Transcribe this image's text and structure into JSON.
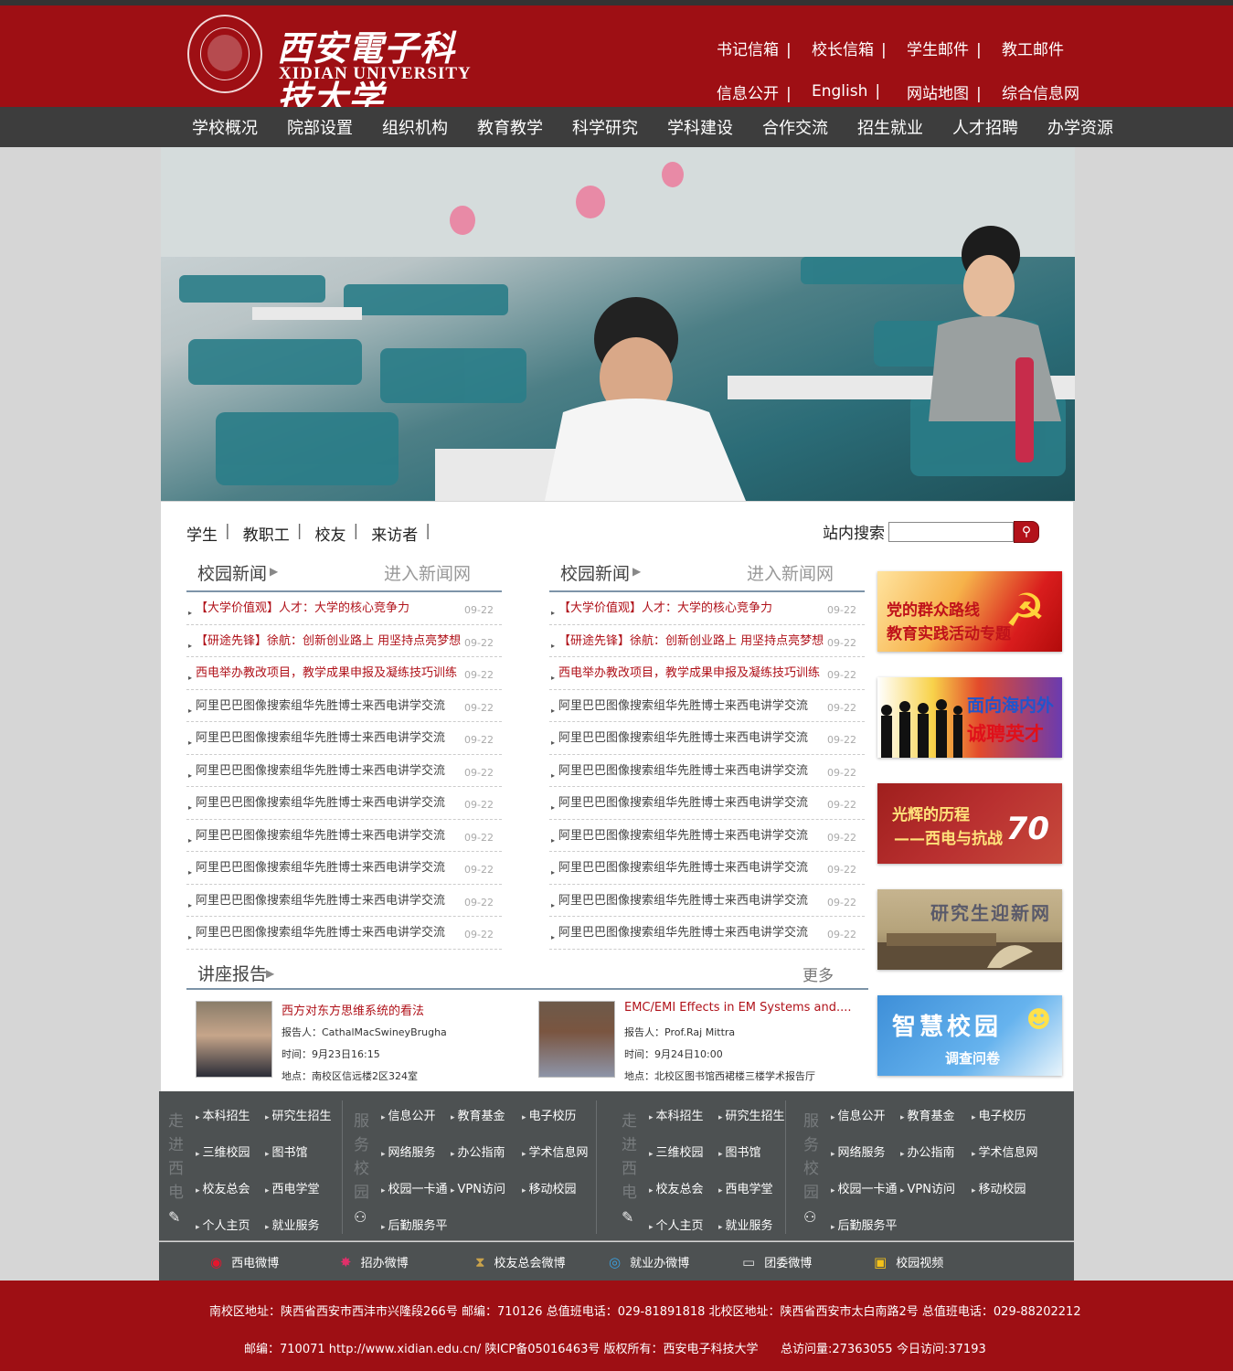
{
  "header": {
    "logo_cn": "西安電子科技大学",
    "logo_en": "XIDIAN UNIVERSITY",
    "links_row1": [
      "书记信箱",
      "校长信箱",
      "学生邮件",
      "教工邮件"
    ],
    "links_row2": [
      "信息公开",
      "English",
      "网站地图",
      "综合信息网"
    ],
    "separator": "|"
  },
  "nav": [
    "学校概况",
    "院部设置",
    "组织机构",
    "教育教学",
    "科学研究",
    "学科建设",
    "合作交流",
    "招生就业",
    "人才招聘",
    "办学资源"
  ],
  "audience": [
    "学生",
    "教职工",
    "校友",
    "来访者"
  ],
  "search": {
    "label": "站内搜索",
    "placeholder": "",
    "button_icon": "search-icon"
  },
  "news_columns": [
    {
      "title": "校园新闻",
      "more": "进入新闻网",
      "items": [
        {
          "text": "【大学价值观】人才：大学的核心竞争力",
          "date": "09-22",
          "red": true
        },
        {
          "text": "【研途先锋】徐航：创新创业路上 用坚持点亮梦想",
          "date": "09-22",
          "red": true
        },
        {
          "text": "西电举办教改项目，教学成果申报及凝练技巧训练",
          "date": "09-22",
          "red": true
        },
        {
          "text": "阿里巴巴图像搜索组华先胜博士来西电讲学交流",
          "date": "09-22",
          "red": false
        },
        {
          "text": "阿里巴巴图像搜索组华先胜博士来西电讲学交流",
          "date": "09-22",
          "red": false
        },
        {
          "text": "阿里巴巴图像搜索组华先胜博士来西电讲学交流",
          "date": "09-22",
          "red": false
        },
        {
          "text": "阿里巴巴图像搜索组华先胜博士来西电讲学交流",
          "date": "09-22",
          "red": false
        },
        {
          "text": "阿里巴巴图像搜索组华先胜博士来西电讲学交流",
          "date": "09-22",
          "red": false
        },
        {
          "text": "阿里巴巴图像搜索组华先胜博士来西电讲学交流",
          "date": "09-22",
          "red": false
        },
        {
          "text": "阿里巴巴图像搜索组华先胜博士来西电讲学交流",
          "date": "09-22",
          "red": false
        },
        {
          "text": "阿里巴巴图像搜索组华先胜博士来西电讲学交流",
          "date": "09-22",
          "red": false
        }
      ]
    },
    {
      "title": "校园新闻",
      "more": "进入新闻网",
      "items": [
        {
          "text": "【大学价值观】人才：大学的核心竞争力",
          "date": "09-22",
          "red": true
        },
        {
          "text": "【研途先锋】徐航：创新创业路上 用坚持点亮梦想",
          "date": "09-22",
          "red": true
        },
        {
          "text": "西电举办教改项目，教学成果申报及凝练技巧训练",
          "date": "09-22",
          "red": true
        },
        {
          "text": "阿里巴巴图像搜索组华先胜博士来西电讲学交流",
          "date": "09-22",
          "red": false
        },
        {
          "text": "阿里巴巴图像搜索组华先胜博士来西电讲学交流",
          "date": "09-22",
          "red": false
        },
        {
          "text": "阿里巴巴图像搜索组华先胜博士来西电讲学交流",
          "date": "09-22",
          "red": false
        },
        {
          "text": "阿里巴巴图像搜索组华先胜博士来西电讲学交流",
          "date": "09-22",
          "red": false
        },
        {
          "text": "阿里巴巴图像搜索组华先胜博士来西电讲学交流",
          "date": "09-22",
          "red": false
        },
        {
          "text": "阿里巴巴图像搜索组华先胜博士来西电讲学交流",
          "date": "09-22",
          "red": false
        },
        {
          "text": "阿里巴巴图像搜索组华先胜博士来西电讲学交流",
          "date": "09-22",
          "red": false
        },
        {
          "text": "阿里巴巴图像搜索组华先胜博士来西电讲学交流",
          "date": "09-22",
          "red": false
        }
      ]
    }
  ],
  "ads": [
    {
      "line1": "党的群众路线",
      "line2": "教育实践活动专题",
      "icon": "hammer-sickle-icon"
    },
    {
      "line1": "面向海内外",
      "line2": "诚聘英才"
    },
    {
      "line1": "光辉的历程",
      "line2": "——西电与抗战",
      "badge": "70"
    },
    {
      "line1": "研究生迎新网"
    },
    {
      "line1": "智慧校园",
      "line2": "调查问卷"
    }
  ],
  "lectures": {
    "title": "讲座报告",
    "more": "更多",
    "items": [
      {
        "title": "西方对东方思维系统的看法",
        "speaker": "报告人：CathalMacSwineyBrugha",
        "time": "时间：9月23日16:15",
        "place": "地点：南校区信远楼2区324室"
      },
      {
        "title": "EMC/EMI Effects in EM Systems and....",
        "speaker": "报告人：Prof.Raj Mittra",
        "time": "时间：9月24日10:00",
        "place": "地点：北校区图书馆西裙楼三楼学术报告厅"
      }
    ]
  },
  "footer_groups": [
    {
      "label": "走进西电",
      "cells": [
        "本科招生",
        "研究生招生",
        "三维校园",
        "图书馆",
        "校友总会",
        "西电学堂",
        "个人主页",
        "就业服务"
      ],
      "icon": "edit-icon"
    },
    {
      "label": "服务校园",
      "cells": [
        "信息公开",
        "教育基金",
        "电子校历",
        "网络服务",
        "办公指南",
        "学术信息网",
        "校园一卡通",
        "VPN访问",
        "移动校园",
        "后勤服务平"
      ],
      "icon": "users-icon"
    },
    {
      "label": "走进西电",
      "cells": [
        "本科招生",
        "研究生招生",
        "三维校园",
        "图书馆",
        "校友总会",
        "西电学堂",
        "个人主页",
        "就业服务"
      ],
      "icon": "edit-icon"
    },
    {
      "label": "服务校园",
      "cells": [
        "信息公开",
        "教育基金",
        "电子校历",
        "网络服务",
        "办公指南",
        "学术信息网",
        "校园一卡通",
        "VPN访问",
        "移动校园",
        "后勤服务平"
      ],
      "icon": "users-icon"
    }
  ],
  "weibo": [
    {
      "label": "西电微博",
      "icon": "weibo-icon"
    },
    {
      "label": "招办微博",
      "icon": "star-icon"
    },
    {
      "label": "校友总会微博",
      "icon": "hourglass-icon"
    },
    {
      "label": "就业办微博",
      "icon": "eye-icon"
    },
    {
      "label": "团委微博",
      "icon": "card-icon"
    },
    {
      "label": "校园视频",
      "icon": "video-icon"
    }
  ],
  "bottom": {
    "address": "南校区地址：陕西省西安市西沣市兴隆段266号 邮编：710126 总值班电话：029-81891818 北校区地址：陕西省西安市太白南路2号 总值班电话：029-88202212",
    "copyright": "邮编：710071 http://www.xidian.edu.cn/ 陕ICP备05016463号 版权所有：西安电子科技大学",
    "total_visits": "总访问量:27363055",
    "today_visits": "今日访问:37193"
  }
}
